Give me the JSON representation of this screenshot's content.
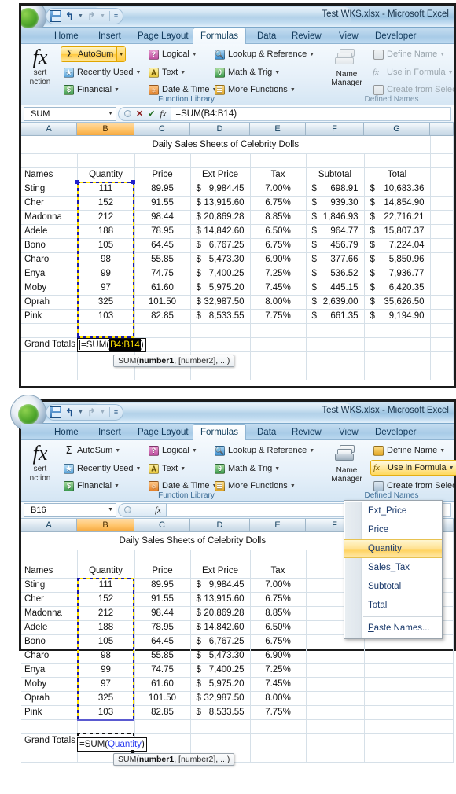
{
  "app": {
    "title": "Test WKS.xlsx - Microsoft Excel",
    "office_button": "office-orb",
    "quick_access": [
      {
        "name": "save",
        "icon": "save-icon"
      },
      {
        "name": "undo",
        "icon": "undo-icon"
      },
      {
        "name": "redo",
        "icon": "redo-icon"
      },
      {
        "name": "customize",
        "icon": "customize-qat-icon"
      }
    ]
  },
  "tabs": [
    {
      "label": "Home",
      "active": false
    },
    {
      "label": "Insert",
      "active": false
    },
    {
      "label": "Page Layout",
      "active": false
    },
    {
      "label": "Formulas",
      "active": true
    },
    {
      "label": "Data",
      "active": false
    },
    {
      "label": "Review",
      "active": false
    },
    {
      "label": "View",
      "active": false
    },
    {
      "label": "Developer",
      "active": false
    }
  ],
  "ribbon": {
    "insert_function": {
      "line1": "sert",
      "line2": "nction"
    },
    "function_library": {
      "group_label": "Function Library",
      "buttons": [
        {
          "label": "AutoSum",
          "icon": "sigma-icon",
          "state": "highlighted",
          "split": true
        },
        {
          "label": "Recently Used",
          "icon": "star-icon",
          "state": "normal"
        },
        {
          "label": "Financial",
          "icon": "money-icon",
          "state": "normal"
        },
        {
          "label": "Logical",
          "icon": "logical-icon",
          "state": "normal"
        },
        {
          "label": "Text",
          "icon": "text-icon",
          "state": "normal"
        },
        {
          "label": "Date & Time",
          "icon": "calendar-icon",
          "state": "normal"
        },
        {
          "label": "Lookup & Reference",
          "icon": "lookup-icon",
          "state": "normal"
        },
        {
          "label": "Math & Trig",
          "icon": "math-icon",
          "state": "normal"
        },
        {
          "label": "More Functions",
          "icon": "more-functions-icon",
          "state": "normal"
        }
      ]
    },
    "defined_names": {
      "group_label": "Defined Names",
      "name_manager": {
        "line1": "Name",
        "line2": "Manager"
      },
      "buttons_win1": [
        {
          "label": "Define Name",
          "state": "disabled"
        },
        {
          "label": "Use in Formula",
          "state": "disabled"
        },
        {
          "label": "Create from Selection",
          "state": "disabled"
        }
      ],
      "buttons_win2": [
        {
          "label": "Define Name",
          "state": "normal"
        },
        {
          "label": "Use in Formula",
          "state": "highlighted"
        },
        {
          "label": "Create from Selection",
          "state": "normal"
        }
      ]
    }
  },
  "window1": {
    "name_box": "SUM",
    "formula_bar": "=SUM(B4:B14)",
    "formula_bar_buttons": [
      "cancel-x",
      "enter-check",
      "insert-function-fx"
    ],
    "columns": [
      "A",
      "B",
      "C",
      "D",
      "E",
      "F",
      "G"
    ],
    "selected_column": "B",
    "sheet_title": "Daily Sales Sheets of Celebrity Dolls",
    "headers": [
      "Names",
      "Quantity",
      "Price",
      "Ext Price",
      "Tax",
      "Subtotal",
      "Total"
    ],
    "rows": [
      {
        "name": "Sting",
        "qty": "111",
        "price": "89.95",
        "ext": "9,984.45",
        "tax": "7.00%",
        "sub": "698.91",
        "total": "10,683.36"
      },
      {
        "name": "Cher",
        "qty": "152",
        "price": "91.55",
        "ext": "13,915.60",
        "tax": "6.75%",
        "sub": "939.30",
        "total": "14,854.90"
      },
      {
        "name": "Madonna",
        "qty": "212",
        "price": "98.44",
        "ext": "20,869.28",
        "tax": "8.85%",
        "sub": "1,846.93",
        "total": "22,716.21"
      },
      {
        "name": "Adele",
        "qty": "188",
        "price": "78.95",
        "ext": "14,842.60",
        "tax": "6.50%",
        "sub": "964.77",
        "total": "15,807.37"
      },
      {
        "name": "Bono",
        "qty": "105",
        "price": "64.45",
        "ext": "6,767.25",
        "tax": "6.75%",
        "sub": "456.79",
        "total": "7,224.04"
      },
      {
        "name": "Charo",
        "qty": "98",
        "price": "55.85",
        "ext": "5,473.30",
        "tax": "6.90%",
        "sub": "377.66",
        "total": "5,850.96"
      },
      {
        "name": "Enya",
        "qty": "99",
        "price": "74.75",
        "ext": "7,400.25",
        "tax": "7.25%",
        "sub": "536.52",
        "total": "7,936.77"
      },
      {
        "name": "Moby",
        "qty": "97",
        "price": "61.60",
        "ext": "5,975.20",
        "tax": "7.45%",
        "sub": "445.15",
        "total": "6,420.35"
      },
      {
        "name": "Oprah",
        "qty": "325",
        "price": "101.50",
        "ext": "32,987.50",
        "tax": "8.00%",
        "sub": "2,639.00",
        "total": "35,626.50"
      },
      {
        "name": "Pink",
        "qty": "103",
        "price": "82.85",
        "ext": "8,533.55",
        "tax": "7.75%",
        "sub": "661.35",
        "total": "9,194.90"
      }
    ],
    "currency_symbol": "$",
    "grand_totals_label": "Grand Totals",
    "cell_edit": {
      "prefix": "=SUM(",
      "reference": "B4:B14",
      "suffix": ")"
    },
    "tooltip": {
      "fn": "SUM(",
      "arg1": "number1",
      "rest": ", [number2], ...)"
    }
  },
  "window2": {
    "name_box": "B16",
    "formula_bar": "",
    "columns": [
      "A",
      "B",
      "C",
      "D",
      "E",
      "F"
    ],
    "selected_column": "B",
    "sheet_title": "Daily Sales Sheets of Celebrity Dolls",
    "headers": [
      "Names",
      "Quantity",
      "Price",
      "Ext Price",
      "Tax"
    ],
    "rows": [
      {
        "name": "Sting",
        "qty": "111",
        "price": "89.95",
        "ext": "9,984.45",
        "tax": "7.00%"
      },
      {
        "name": "Cher",
        "qty": "152",
        "price": "91.55",
        "ext": "13,915.60",
        "tax": "6.75%"
      },
      {
        "name": "Madonna",
        "qty": "212",
        "price": "98.44",
        "ext": "20,869.28",
        "tax": "8.85%"
      },
      {
        "name": "Adele",
        "qty": "188",
        "price": "78.95",
        "ext": "14,842.60",
        "tax": "6.50%"
      },
      {
        "name": "Bono",
        "qty": "105",
        "price": "64.45",
        "ext": "6,767.25",
        "tax": "6.75%"
      },
      {
        "name": "Charo",
        "qty": "98",
        "price": "55.85",
        "ext": "5,473.30",
        "tax": "6.90%"
      },
      {
        "name": "Enya",
        "qty": "99",
        "price": "74.75",
        "ext": "7,400.25",
        "tax": "7.25%"
      },
      {
        "name": "Moby",
        "qty": "97",
        "price": "61.60",
        "ext": "5,975.20",
        "tax": "7.45%"
      },
      {
        "name": "Oprah",
        "qty": "325",
        "price": "101.50",
        "ext": "32,987.50",
        "tax": "8.00%"
      },
      {
        "name": "Pink",
        "qty": "103",
        "price": "82.85",
        "ext": "8,533.55",
        "tax": "7.75%"
      }
    ],
    "currency_symbol": "$",
    "grand_totals_label": "Grand Totals",
    "cell_edit": {
      "prefix": "=SUM(",
      "reference": "Quantity",
      "suffix": ")"
    },
    "tooltip": {
      "fn": "SUM(",
      "arg1": "number1",
      "rest": ", [number2], ...)"
    },
    "name_menu": {
      "items": [
        {
          "label": "Ext_Price",
          "selected": false
        },
        {
          "label": "Price",
          "selected": false
        },
        {
          "label": "Quantity",
          "selected": true
        },
        {
          "label": "Sales_Tax",
          "selected": false
        },
        {
          "label": "Subtotal",
          "selected": false
        },
        {
          "label": "Total",
          "selected": false
        }
      ],
      "footer": {
        "accel": "P",
        "rest": "aste Names..."
      }
    }
  },
  "colors": {
    "accent_blue": "#1b3a6b",
    "highlight_gold": "#ffd055",
    "selected_header": "#f5a93f",
    "reference_blue": "#2b3df0",
    "ants_yellow": "#ffe100"
  }
}
